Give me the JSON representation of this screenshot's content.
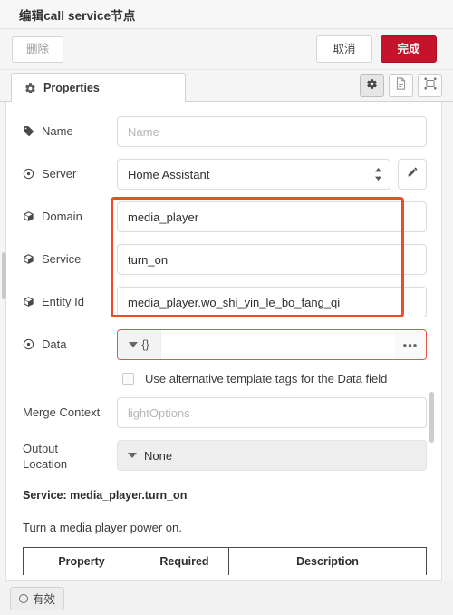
{
  "dialog": {
    "title": "编辑call service节点"
  },
  "actions": {
    "delete_label": "删除",
    "cancel_label": "取消",
    "done_label": "完成",
    "done_color": "#c4132b"
  },
  "tabs": [
    {
      "label": "Properties",
      "icon": "gear-icon",
      "active": true
    }
  ],
  "toolbar_icons": [
    {
      "name": "gear-icon",
      "active": true
    },
    {
      "name": "file-document-icon",
      "active": false
    },
    {
      "name": "select-node-icon",
      "active": false
    }
  ],
  "form": {
    "fields": [
      {
        "key": "name",
        "label": "Name",
        "icon": "tag-icon",
        "type": "text",
        "value": "",
        "placeholder": "Name"
      },
      {
        "key": "server",
        "label": "Server",
        "icon": "target-icon",
        "type": "select",
        "value": "Home Assistant",
        "edit_button": "pencil-icon"
      },
      {
        "key": "domain",
        "label": "Domain",
        "icon": "cube-icon",
        "type": "text",
        "value": "media_player",
        "placeholder": ""
      },
      {
        "key": "service",
        "label": "Service",
        "icon": "cube-icon",
        "type": "text",
        "value": "turn_on",
        "placeholder": ""
      },
      {
        "key": "entity_id",
        "label": "Entity Id",
        "icon": "cube-icon",
        "type": "text",
        "value": "media_player.wo_shi_yin_le_bo_fang_qi",
        "placeholder": ""
      }
    ],
    "data_field": {
      "label": "Data",
      "icon": "target-icon",
      "type_label": "{}",
      "value": "",
      "expand_label": "•••",
      "highlight_color": "#e0574a"
    },
    "alt_tags_checkbox": {
      "label": "Use alternative template tags for the Data field",
      "checked": false
    },
    "merge_context": {
      "label": "Merge Context",
      "value": "",
      "placeholder": "lightOptions"
    },
    "output_location": {
      "label_line1": "Output",
      "label_line2": "Location",
      "value": "None"
    }
  },
  "service_info": {
    "title": "Service: media_player.turn_on",
    "description": "Turn a media player power on.",
    "table_headers": [
      "Property",
      "Required",
      "Description"
    ]
  },
  "footer": {
    "enabled_label": "有效"
  },
  "annotation": {
    "box_color": "#ef4b28"
  },
  "watermark": {
    "text": ""
  }
}
